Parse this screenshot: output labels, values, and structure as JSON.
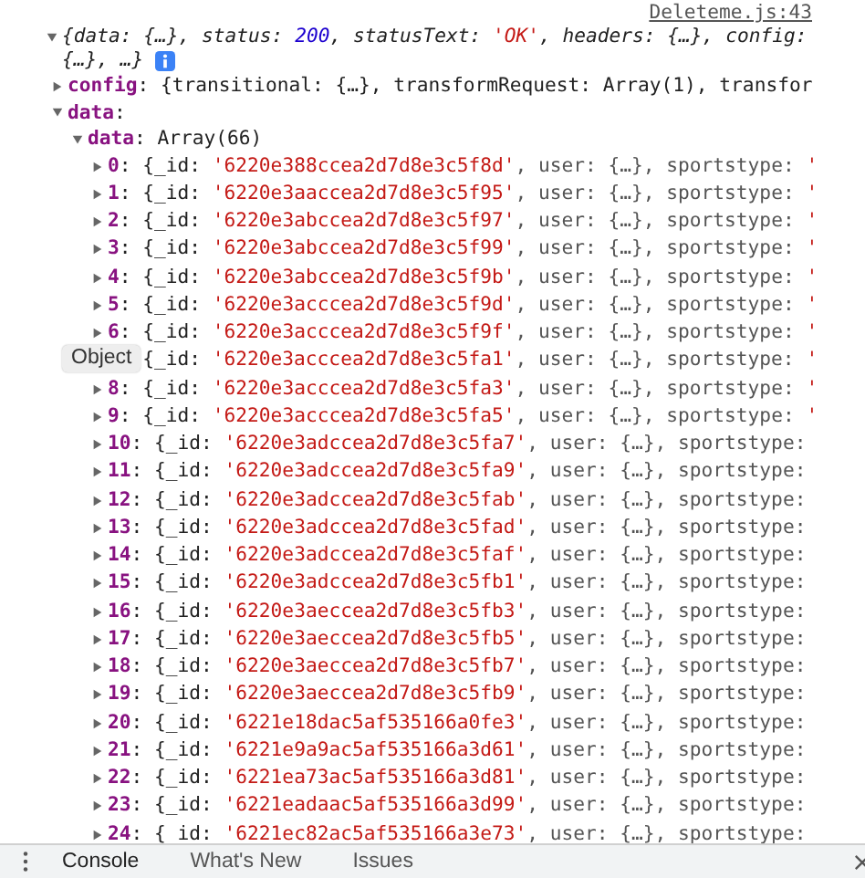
{
  "source_link": "Deleteme.js:43",
  "log": {
    "expanded": true,
    "preview_lines": [
      [
        {
          "text": "{data: {…}, status: ",
          "kind": "plain"
        },
        {
          "text": "200",
          "kind": "num"
        },
        {
          "text": ", statusText: ",
          "kind": "plain"
        },
        {
          "text": "'OK'",
          "kind": "str"
        },
        {
          "text": ", headers: {…}, config:",
          "kind": "plain"
        }
      ],
      [
        {
          "text": "{…}, …}",
          "kind": "plain"
        }
      ]
    ],
    "children": [
      {
        "key": "config",
        "expanded": false,
        "value": [
          {
            "text": ": {transitional: {…}, transformRequest: Array(1), transfor",
            "kind": "plain"
          }
        ]
      },
      {
        "key": "data",
        "expanded": true,
        "value": [
          {
            "text": ":",
            "kind": "plain"
          }
        ],
        "children": [
          {
            "key": "data",
            "expanded": true,
            "value": [
              {
                "text": ": Array(66)",
                "kind": "plain"
              }
            ],
            "children": [
              {
                "key": "0",
                "expanded": false,
                "value": [
                  {
                    "text": ": {_id: ",
                    "kind": "plain"
                  },
                  {
                    "text": "'6220e388ccea2d7d8e3c5f8d'",
                    "kind": "str"
                  },
                  {
                    "text": ", user: {…}, sportstype: ",
                    "kind": "dim"
                  },
                  {
                    "text": "'",
                    "kind": "str"
                  }
                ]
              },
              {
                "key": "1",
                "expanded": false,
                "value": [
                  {
                    "text": ": {_id: ",
                    "kind": "plain"
                  },
                  {
                    "text": "'6220e3aaccea2d7d8e3c5f95'",
                    "kind": "str"
                  },
                  {
                    "text": ", user: {…}, sportstype: ",
                    "kind": "dim"
                  },
                  {
                    "text": "'",
                    "kind": "str"
                  }
                ]
              },
              {
                "key": "2",
                "expanded": false,
                "value": [
                  {
                    "text": ": {_id: ",
                    "kind": "plain"
                  },
                  {
                    "text": "'6220e3abccea2d7d8e3c5f97'",
                    "kind": "str"
                  },
                  {
                    "text": ", user: {…}, sportstype: ",
                    "kind": "dim"
                  },
                  {
                    "text": "'",
                    "kind": "str"
                  }
                ]
              },
              {
                "key": "3",
                "expanded": false,
                "value": [
                  {
                    "text": ": {_id: ",
                    "kind": "plain"
                  },
                  {
                    "text": "'6220e3abccea2d7d8e3c5f99'",
                    "kind": "str"
                  },
                  {
                    "text": ", user: {…}, sportstype: ",
                    "kind": "dim"
                  },
                  {
                    "text": "'",
                    "kind": "str"
                  }
                ]
              },
              {
                "key": "4",
                "expanded": false,
                "value": [
                  {
                    "text": ": {_id: ",
                    "kind": "plain"
                  },
                  {
                    "text": "'6220e3abccea2d7d8e3c5f9b'",
                    "kind": "str"
                  },
                  {
                    "text": ", user: {…}, sportstype: ",
                    "kind": "dim"
                  },
                  {
                    "text": "'",
                    "kind": "str"
                  }
                ]
              },
              {
                "key": "5",
                "expanded": false,
                "value": [
                  {
                    "text": ": {_id: ",
                    "kind": "plain"
                  },
                  {
                    "text": "'6220e3acccea2d7d8e3c5f9d'",
                    "kind": "str"
                  },
                  {
                    "text": ", user: {…}, sportstype: ",
                    "kind": "dim"
                  },
                  {
                    "text": "'",
                    "kind": "str"
                  }
                ]
              },
              {
                "key": "6",
                "expanded": false,
                "value": [
                  {
                    "text": ": {_id: ",
                    "kind": "plain"
                  },
                  {
                    "text": "'6220e3acccea2d7d8e3c5f9f'",
                    "kind": "str"
                  },
                  {
                    "text": ", user: {…}, sportstype: ",
                    "kind": "dim"
                  },
                  {
                    "text": "'",
                    "kind": "str"
                  }
                ]
              },
              {
                "value": [
                  {
                    "text": "{_id: ",
                    "kind": "plain"
                  },
                  {
                    "text": "'6220e3acccea2d7d8e3c5fa1'",
                    "kind": "str"
                  },
                  {
                    "text": ", user: {…}, sportstype: ",
                    "kind": "dim"
                  },
                  {
                    "text": "'",
                    "kind": "str"
                  }
                ]
              },
              {
                "key": "8",
                "expanded": false,
                "value": [
                  {
                    "text": ": {_id: ",
                    "kind": "plain"
                  },
                  {
                    "text": "'6220e3acccea2d7d8e3c5fa3'",
                    "kind": "str"
                  },
                  {
                    "text": ", user: {…}, sportstype: ",
                    "kind": "dim"
                  },
                  {
                    "text": "'",
                    "kind": "str"
                  }
                ]
              },
              {
                "key": "9",
                "expanded": false,
                "value": [
                  {
                    "text": ": {_id: ",
                    "kind": "plain"
                  },
                  {
                    "text": "'6220e3acccea2d7d8e3c5fa5'",
                    "kind": "str"
                  },
                  {
                    "text": ", user: {…}, sportstype: ",
                    "kind": "dim"
                  },
                  {
                    "text": "'",
                    "kind": "str"
                  }
                ]
              },
              {
                "key": "10",
                "expanded": false,
                "value": [
                  {
                    "text": ": {_id: ",
                    "kind": "plain"
                  },
                  {
                    "text": "'6220e3adccea2d7d8e3c5fa7'",
                    "kind": "str"
                  },
                  {
                    "text": ", user: {…}, sportstype:",
                    "kind": "dim"
                  }
                ]
              },
              {
                "key": "11",
                "expanded": false,
                "value": [
                  {
                    "text": ": {_id: ",
                    "kind": "plain"
                  },
                  {
                    "text": "'6220e3adccea2d7d8e3c5fa9'",
                    "kind": "str"
                  },
                  {
                    "text": ", user: {…}, sportstype:",
                    "kind": "dim"
                  }
                ]
              },
              {
                "key": "12",
                "expanded": false,
                "value": [
                  {
                    "text": ": {_id: ",
                    "kind": "plain"
                  },
                  {
                    "text": "'6220e3adccea2d7d8e3c5fab'",
                    "kind": "str"
                  },
                  {
                    "text": ", user: {…}, sportstype:",
                    "kind": "dim"
                  }
                ]
              },
              {
                "key": "13",
                "expanded": false,
                "value": [
                  {
                    "text": ": {_id: ",
                    "kind": "plain"
                  },
                  {
                    "text": "'6220e3adccea2d7d8e3c5fad'",
                    "kind": "str"
                  },
                  {
                    "text": ", user: {…}, sportstype:",
                    "kind": "dim"
                  }
                ]
              },
              {
                "key": "14",
                "expanded": false,
                "value": [
                  {
                    "text": ": {_id: ",
                    "kind": "plain"
                  },
                  {
                    "text": "'6220e3adccea2d7d8e3c5faf'",
                    "kind": "str"
                  },
                  {
                    "text": ", user: {…}, sportstype:",
                    "kind": "dim"
                  }
                ]
              },
              {
                "key": "15",
                "expanded": false,
                "value": [
                  {
                    "text": ": {_id: ",
                    "kind": "plain"
                  },
                  {
                    "text": "'6220e3adccea2d7d8e3c5fb1'",
                    "kind": "str"
                  },
                  {
                    "text": ", user: {…}, sportstype:",
                    "kind": "dim"
                  }
                ]
              },
              {
                "key": "16",
                "expanded": false,
                "value": [
                  {
                    "text": ": {_id: ",
                    "kind": "plain"
                  },
                  {
                    "text": "'6220e3aeccea2d7d8e3c5fb3'",
                    "kind": "str"
                  },
                  {
                    "text": ", user: {…}, sportstype:",
                    "kind": "dim"
                  }
                ]
              },
              {
                "key": "17",
                "expanded": false,
                "value": [
                  {
                    "text": ": {_id: ",
                    "kind": "plain"
                  },
                  {
                    "text": "'6220e3aeccea2d7d8e3c5fb5'",
                    "kind": "str"
                  },
                  {
                    "text": ", user: {…}, sportstype:",
                    "kind": "dim"
                  }
                ]
              },
              {
                "key": "18",
                "expanded": false,
                "value": [
                  {
                    "text": ": {_id: ",
                    "kind": "plain"
                  },
                  {
                    "text": "'6220e3aeccea2d7d8e3c5fb7'",
                    "kind": "str"
                  },
                  {
                    "text": ", user: {…}, sportstype:",
                    "kind": "dim"
                  }
                ]
              },
              {
                "key": "19",
                "expanded": false,
                "value": [
                  {
                    "text": ": {_id: ",
                    "kind": "plain"
                  },
                  {
                    "text": "'6220e3aeccea2d7d8e3c5fb9'",
                    "kind": "str"
                  },
                  {
                    "text": ", user: {…}, sportstype:",
                    "kind": "dim"
                  }
                ]
              },
              {
                "key": "20",
                "expanded": false,
                "value": [
                  {
                    "text": ": {_id: ",
                    "kind": "plain"
                  },
                  {
                    "text": "'6221e18dac5af535166a0fe3'",
                    "kind": "str"
                  },
                  {
                    "text": ", user: {…}, sportstype:",
                    "kind": "dim"
                  }
                ]
              },
              {
                "key": "21",
                "expanded": false,
                "value": [
                  {
                    "text": ": {_id: ",
                    "kind": "plain"
                  },
                  {
                    "text": "'6221e9a9ac5af535166a3d61'",
                    "kind": "str"
                  },
                  {
                    "text": ", user: {…}, sportstype:",
                    "kind": "dim"
                  }
                ]
              },
              {
                "key": "22",
                "expanded": false,
                "value": [
                  {
                    "text": ": {_id: ",
                    "kind": "plain"
                  },
                  {
                    "text": "'6221ea73ac5af535166a3d81'",
                    "kind": "str"
                  },
                  {
                    "text": ", user: {…}, sportstype:",
                    "kind": "dim"
                  }
                ]
              },
              {
                "key": "23",
                "expanded": false,
                "value": [
                  {
                    "text": ": {_id: ",
                    "kind": "plain"
                  },
                  {
                    "text": "'6221eadaac5af535166a3d99'",
                    "kind": "str"
                  },
                  {
                    "text": ", user: {…}, sportstype:",
                    "kind": "dim"
                  }
                ]
              },
              {
                "key": "24",
                "expanded": false,
                "value": [
                  {
                    "text": ": {_id: ",
                    "kind": "plain"
                  },
                  {
                    "text": "'6221ec82ac5af535166a3e73'",
                    "kind": "str"
                  },
                  {
                    "text": ", user: {…}, sportstype:",
                    "kind": "dim"
                  }
                ]
              }
            ]
          }
        ]
      }
    ]
  },
  "tooltip": "Object",
  "drawer_tabs": [
    {
      "label": "Console",
      "selected": true
    },
    {
      "label": "What's New",
      "selected": false
    },
    {
      "label": "Issues",
      "selected": false
    }
  ]
}
